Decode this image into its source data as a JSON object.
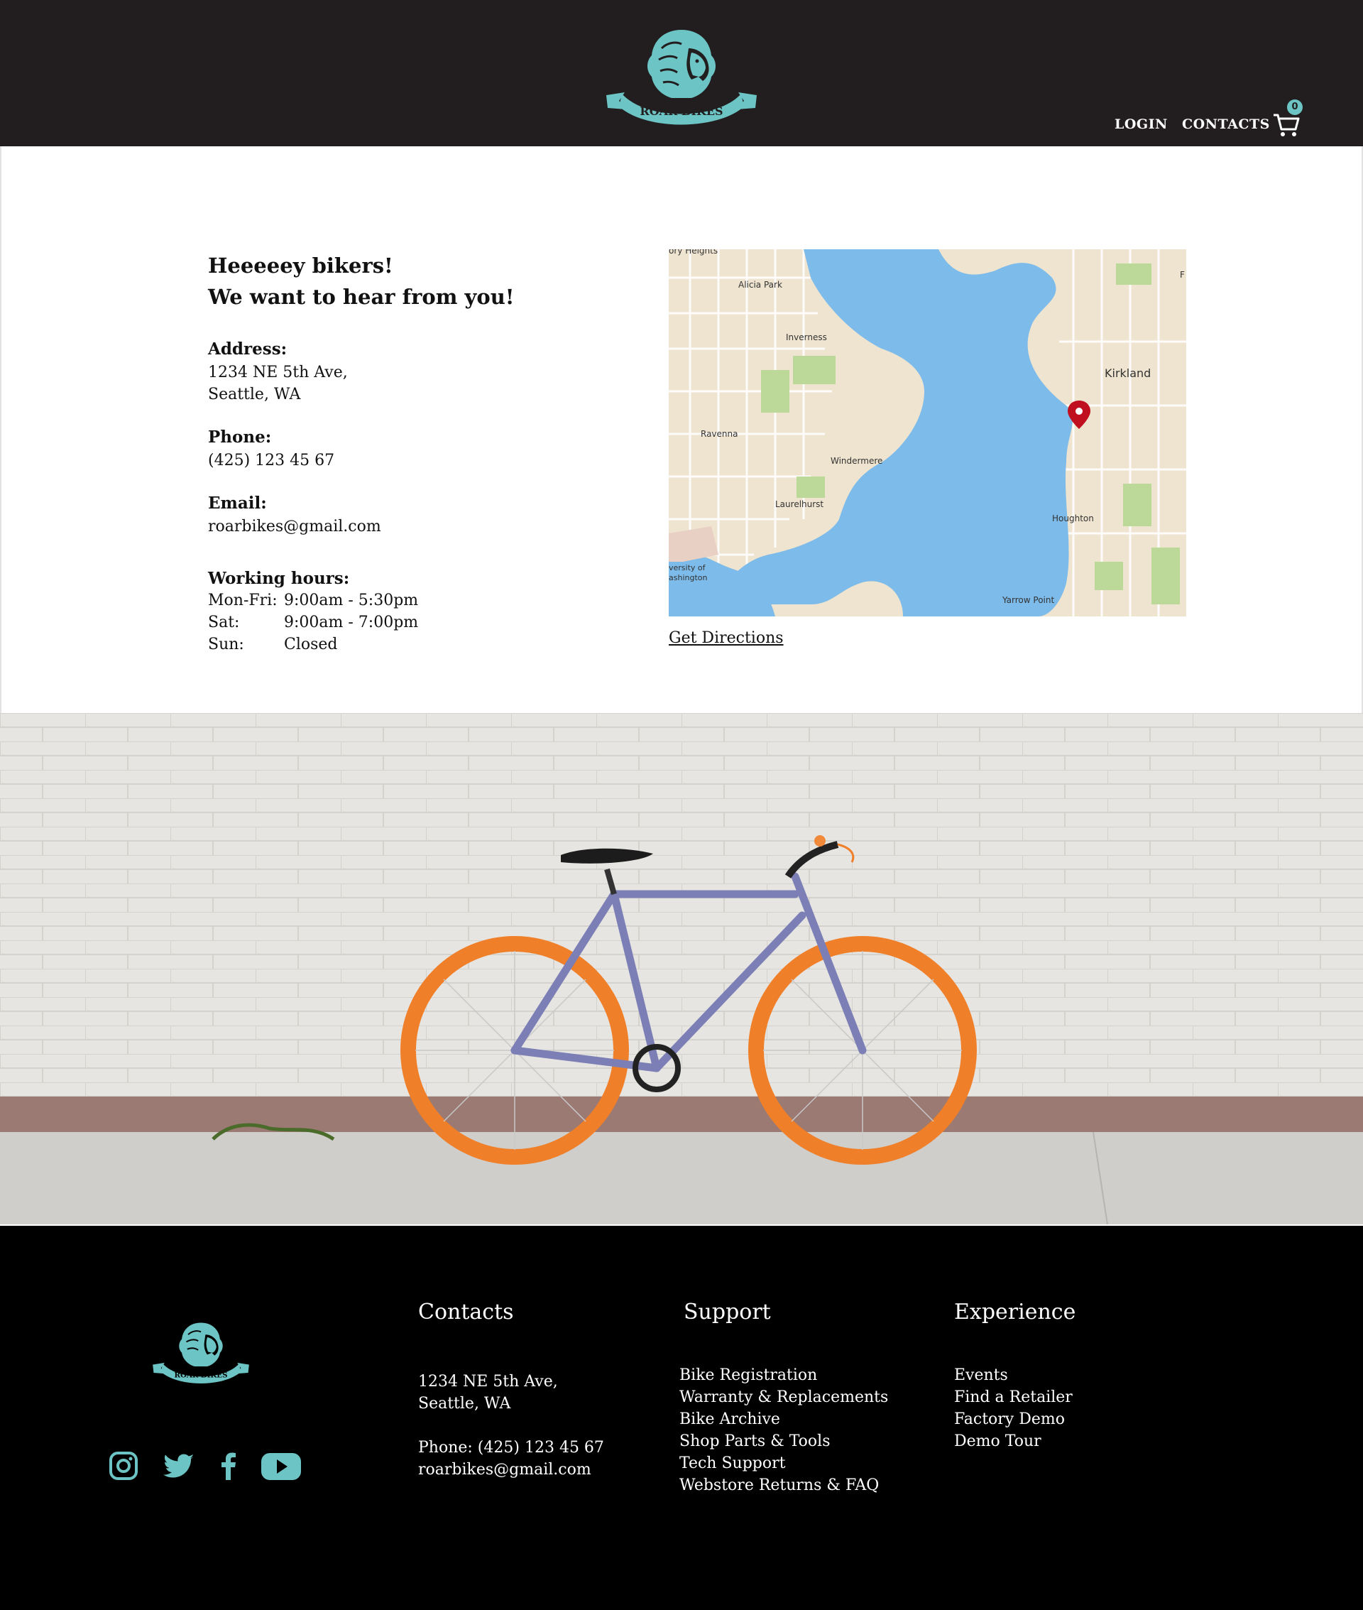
{
  "header": {
    "brand": "ROAR BIKES",
    "nav": {
      "login": "LOGIN",
      "contacts": "CONTACTS"
    },
    "cart_count": "0"
  },
  "contact": {
    "greeting_line1": "Heeeeey bikers!",
    "greeting_line2": "We want to hear from you!",
    "address_label": "Address:",
    "address_line1": "1234 NE 5th Ave,",
    "address_line2": "Seattle, WA",
    "phone_label": "Phone:",
    "phone_value": "(425) 123 45 67",
    "email_label": "Email:",
    "email_value": "roarbikes@gmail.com",
    "hours_label": "Working hours:",
    "hours": [
      {
        "day": "Mon-Fri:",
        "time": "9:00am - 5:30pm"
      },
      {
        "day": "Sat:",
        "time": "9:00am - 7:00pm"
      },
      {
        "day": "Sun:",
        "time": "Closed"
      }
    ],
    "directions_label": "Get Directions"
  },
  "map": {
    "labels": {
      "top_heights": "ory Heights",
      "alicia_park": "Alicia Park",
      "inverness": "Inverness",
      "kirkland": "Kirkland",
      "ravenna": "Ravenna",
      "windermere": "Windermere",
      "laurelhurst": "Laurelhurst",
      "houghton": "Houghton",
      "university_1": "versity of",
      "university_2": "ashington",
      "yarrow_point": "Yarrow Point",
      "edge_f": "F"
    },
    "colors": {
      "water": "#7cbbea",
      "land": "#efe4cf",
      "park": "#bcd99a",
      "pin": "#c0101f"
    }
  },
  "footer": {
    "contacts_heading": "Contacts",
    "support_heading": "Support",
    "experience_heading": "Experience",
    "address_line1": "1234 NE 5th Ave,",
    "address_line2": "Seattle, WA",
    "phone": "Phone: (425) 123 45 67",
    "email": "roarbikes@gmail.com",
    "support_links": [
      "Bike Registration",
      "Warranty & Replacements",
      "Bike Archive",
      "Shop Parts & Tools",
      "Tech Support",
      "Webstore Returns & FAQ"
    ],
    "experience_links": [
      "Events",
      "Find a Retailer",
      "Factory Demo",
      "Demo Tour"
    ],
    "social_icons": [
      "instagram-icon",
      "twitter-icon",
      "facebook-icon",
      "youtube-icon"
    ]
  },
  "colors": {
    "accent": "#6cc4c4",
    "header_bg": "#221e1f",
    "footer_bg": "#000000"
  }
}
